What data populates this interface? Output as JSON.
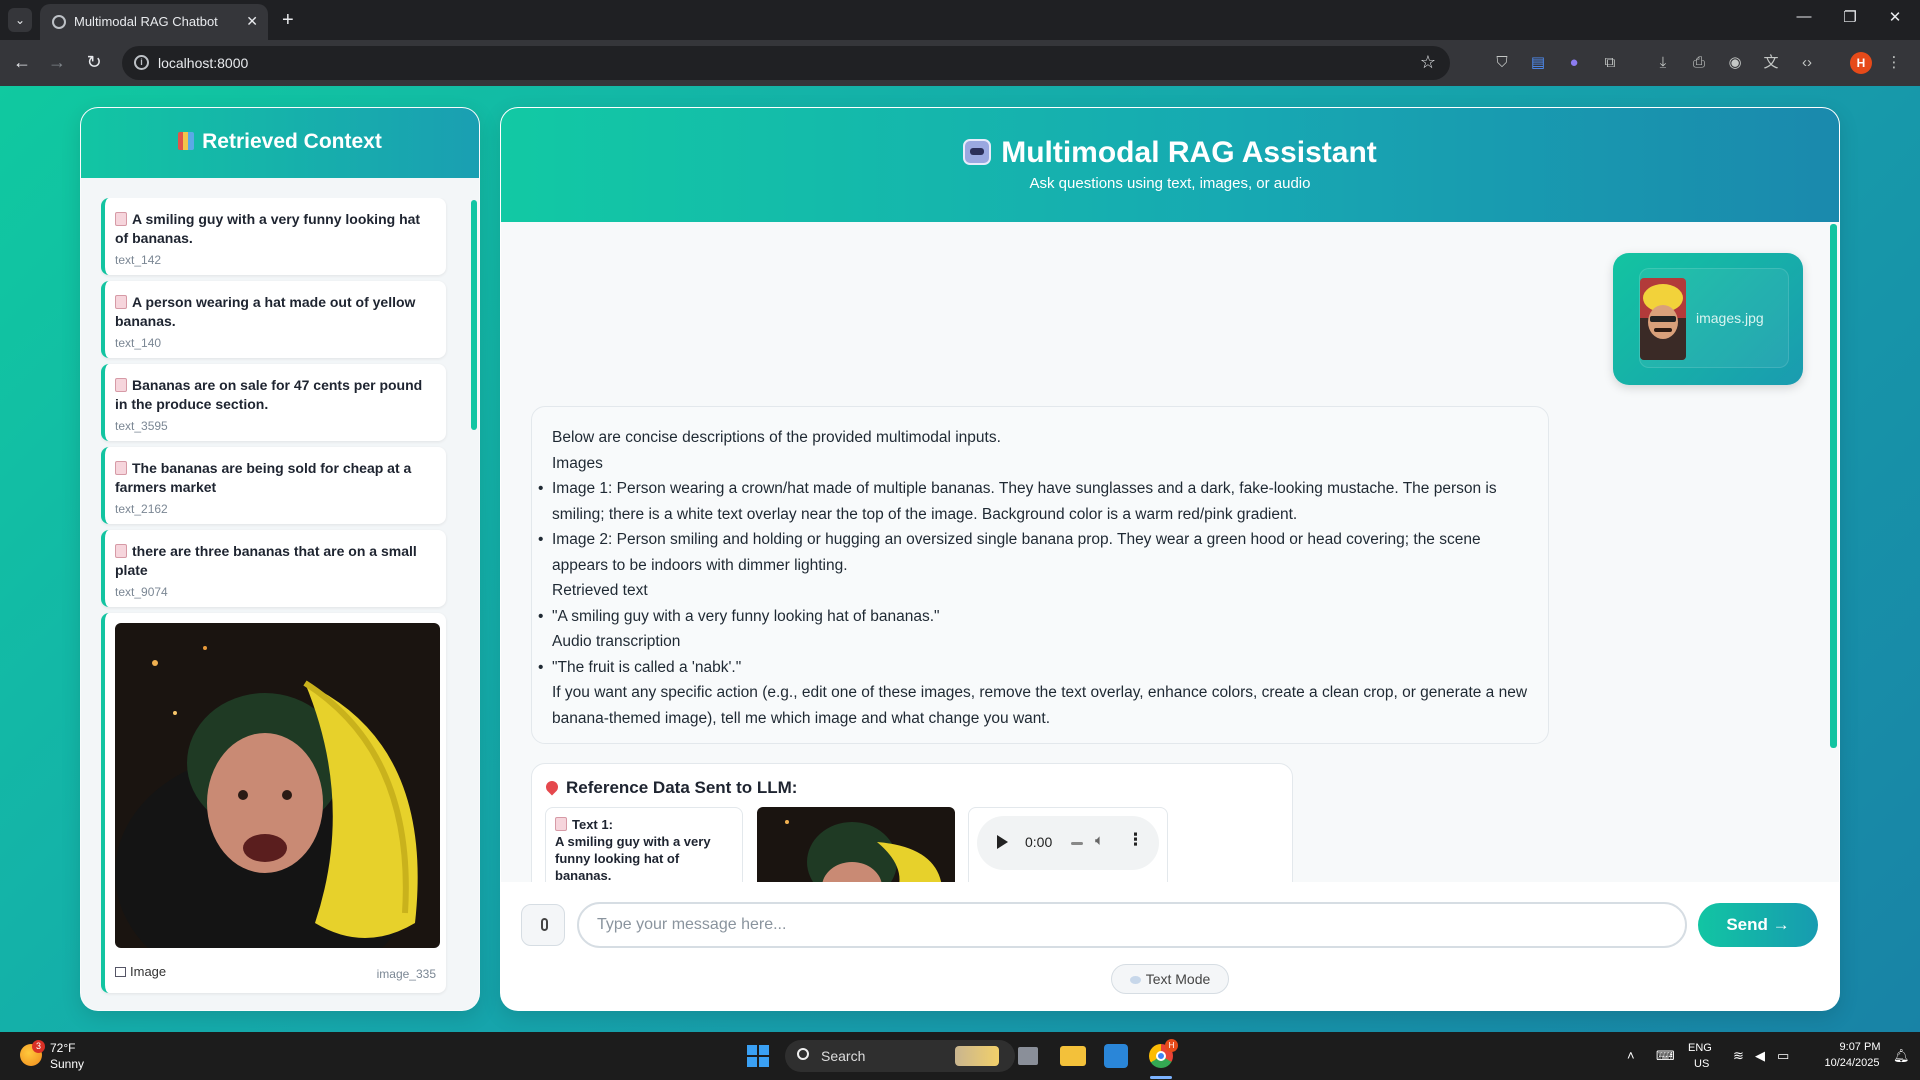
{
  "browser": {
    "tab_title": "Multimodal RAG Chatbot",
    "url": "localhost:8000",
    "profile_initial": "H"
  },
  "sidebar": {
    "title": "Retrieved Context",
    "items": [
      {
        "text": "A smiling guy with a very funny looking hat of bananas.",
        "id": "text_142"
      },
      {
        "text": "A person wearing a hat made out of yellow bananas.",
        "id": "text_140"
      },
      {
        "text": "Bananas are on sale for 47 cents per pound in the produce section.",
        "id": "text_3595"
      },
      {
        "text": "The bananas are being sold for cheap at a farmers market",
        "id": "text_2162"
      },
      {
        "text": "there are three bananas that are on a small plate",
        "id": "text_9074"
      }
    ],
    "image_item": {
      "label": "Image",
      "id": "image_335"
    }
  },
  "main": {
    "title": "Multimodal RAG Assistant",
    "subtitle": "Ask questions using text, images, or audio"
  },
  "user_message": {
    "filename": "images.jpg"
  },
  "assistant_message": {
    "intro": "Below are concise descriptions of the provided multimodal inputs.",
    "section_images": "Images",
    "images_bullets": [
      "Image 1: Person wearing a crown/hat made of multiple bananas. They have sunglasses and a dark, fake-looking mustache. The person is smiling; there is a white text overlay near the top of the image. Background color is a warm red/pink gradient.",
      "Image 2: Person smiling and holding or hugging an oversized single banana prop. They wear a green hood or head covering; the scene appears to be indoors with dimmer lighting."
    ],
    "section_text": "Retrieved text",
    "text_bullets": [
      "\"A smiling guy with a very funny looking hat of bananas.\""
    ],
    "section_audio": "Audio transcription",
    "audio_bullets": [
      "\"The fruit is called a 'nabk'.\""
    ],
    "outro": "If you want any specific action (e.g., edit one of these images, remove the text overlay, enhance colors, create a clean crop, or generate a new banana-themed image), tell me which image and what change you want."
  },
  "reference": {
    "title": "Reference Data Sent to LLM:",
    "text_label": "Text 1:",
    "text_value": "A smiling guy with a very funny looking hat of bananas.",
    "audio_time": "0:00"
  },
  "composer": {
    "placeholder": "Type your message here...",
    "send_label": "Send →",
    "mode_label": "Text Mode"
  },
  "taskbar": {
    "weather_temp": "72°F",
    "weather_condition": "Sunny",
    "weather_badge": "3",
    "search_label": "Search",
    "lang_top": "ENG",
    "lang_bottom": "US",
    "time": "9:07 PM",
    "date": "10/24/2025",
    "chrome_badge": "H"
  },
  "colors": {
    "accent": "#13c4a1",
    "accent_dark": "#1a9bb0",
    "send_gradient_start": "#12c5a3"
  }
}
